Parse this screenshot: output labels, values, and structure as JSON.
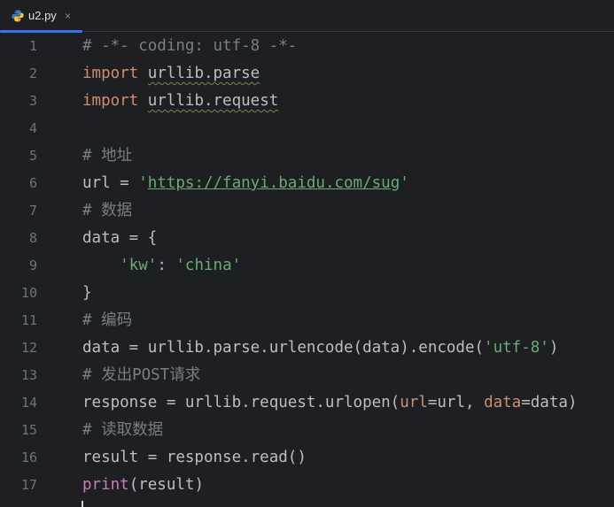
{
  "tab": {
    "label": "u2.py",
    "close_glyph": "×",
    "icon": "python-icon"
  },
  "colors": {
    "background": "#1e1f22",
    "keyword": "#cf8e6d",
    "comment": "#7a7e85",
    "string": "#6aab73",
    "builtin_function": "#c77dbb",
    "default_text": "#bcbec4",
    "line_number": "#6f737a",
    "tab_accent": "#3574f0"
  },
  "lines": [
    {
      "n": "1",
      "parts": [
        {
          "t": "# -*- coding: utf-8 -*-",
          "c": "cm"
        }
      ]
    },
    {
      "n": "2",
      "parts": [
        {
          "t": "import",
          "c": "kw"
        },
        {
          "t": " "
        },
        {
          "t": "urllib.parse",
          "c": "mod"
        }
      ]
    },
    {
      "n": "3",
      "parts": [
        {
          "t": "import",
          "c": "kw"
        },
        {
          "t": " "
        },
        {
          "t": "urllib.request",
          "c": "mod"
        }
      ]
    },
    {
      "n": "4",
      "parts": []
    },
    {
      "n": "5",
      "parts": [
        {
          "t": "# ",
          "c": "cm"
        },
        {
          "t": "地址",
          "c": "cm cjk"
        }
      ]
    },
    {
      "n": "6",
      "parts": [
        {
          "t": "url = "
        },
        {
          "t": "'",
          "c": "str"
        },
        {
          "t": "https://fanyi.baidu.com/sug",
          "c": "url"
        },
        {
          "t": "'",
          "c": "str"
        }
      ]
    },
    {
      "n": "7",
      "parts": [
        {
          "t": "# ",
          "c": "cm"
        },
        {
          "t": "数据",
          "c": "cm cjk"
        }
      ]
    },
    {
      "n": "8",
      "parts": [
        {
          "t": "data = {"
        }
      ]
    },
    {
      "n": "9",
      "parts": [
        {
          "t": "    "
        },
        {
          "t": "'kw'",
          "c": "str"
        },
        {
          "t": ": "
        },
        {
          "t": "'china'",
          "c": "str"
        }
      ]
    },
    {
      "n": "10",
      "parts": [
        {
          "t": "}"
        }
      ]
    },
    {
      "n": "11",
      "parts": [
        {
          "t": "# ",
          "c": "cm"
        },
        {
          "t": "编码",
          "c": "cm cjk"
        }
      ]
    },
    {
      "n": "12",
      "parts": [
        {
          "t": "data = urllib.parse.urlencode(data).encode("
        },
        {
          "t": "'utf-8'",
          "c": "str"
        },
        {
          "t": ")"
        }
      ]
    },
    {
      "n": "13",
      "parts": [
        {
          "t": "# ",
          "c": "cm"
        },
        {
          "t": "发出",
          "c": "cm cjk"
        },
        {
          "t": "POST",
          "c": "cm"
        },
        {
          "t": "请求",
          "c": "cm cjk"
        }
      ]
    },
    {
      "n": "14",
      "parts": [
        {
          "t": "response = urllib.request.urlopen("
        },
        {
          "t": "url",
          "c": "param"
        },
        {
          "t": "=url, "
        },
        {
          "t": "data",
          "c": "param"
        },
        {
          "t": "=data)"
        }
      ]
    },
    {
      "n": "15",
      "parts": [
        {
          "t": "# ",
          "c": "cm"
        },
        {
          "t": "读取数据",
          "c": "cm cjk"
        }
      ]
    },
    {
      "n": "16",
      "parts": [
        {
          "t": "result = response.read()"
        }
      ]
    },
    {
      "n": "17",
      "parts": [
        {
          "t": "print",
          "c": "fn"
        },
        {
          "t": "(result)"
        }
      ]
    }
  ]
}
